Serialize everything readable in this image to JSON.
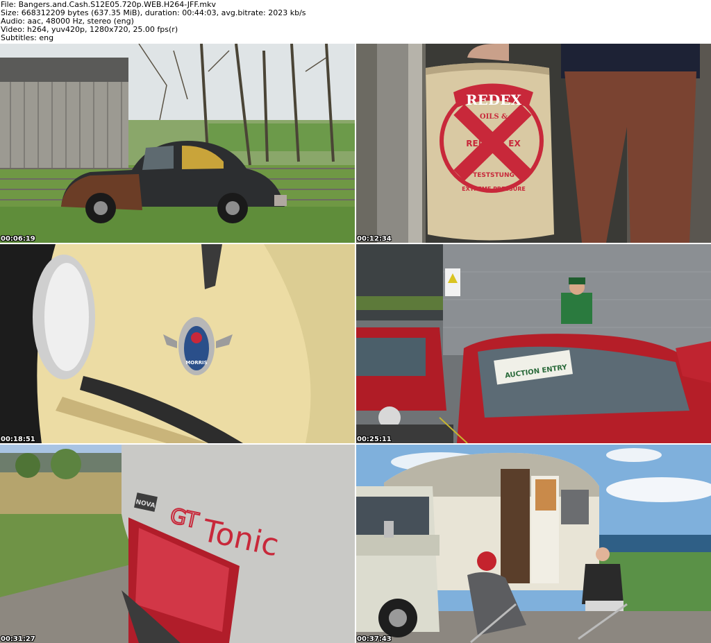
{
  "header": {
    "file": "File: Bangers.and.Cash.S12E05.720p.WEB.H264-JFF.mkv",
    "size": "Size: 668312209 bytes (637.35 MiB), duration: 00:44:03, avg.bitrate: 2023 kb/s",
    "audio": "Audio: aac, 48000 Hz, stereo (eng)",
    "video": "Video: h264, yuv420p, 1280x720, 25.00 fps(r)",
    "subtitles": "Subtitles: eng"
  },
  "thumbnails": [
    {
      "timestamp": "00:06:19"
    },
    {
      "timestamp": "00:12:34"
    },
    {
      "timestamp": "00:18:51"
    },
    {
      "timestamp": "00:25:11"
    },
    {
      "timestamp": "00:31:27"
    },
    {
      "timestamp": "00:37:43"
    }
  ],
  "labels": {
    "redex_brand": "REDEX",
    "redex_oils": "OILS &",
    "redex_x_left": "RED",
    "redex_x_right": "EX",
    "redex_test": "TESTSTUNG",
    "redex_pressure": "EXTREME PRESSURE",
    "morris_badge": "MORRIS",
    "auction_sign": "AUCTION ENTRY",
    "gt_badge": "GT",
    "tonic_text": "Tonic",
    "vauxhall_badge": "NOVA"
  },
  "colors": {
    "redex_red": "#c8283a",
    "tin": "#d9c9a3",
    "mini_red": "#b01c26",
    "cream": "#ecdca4",
    "silver": "#c9c9c6",
    "sky": "#7fb0dc"
  }
}
